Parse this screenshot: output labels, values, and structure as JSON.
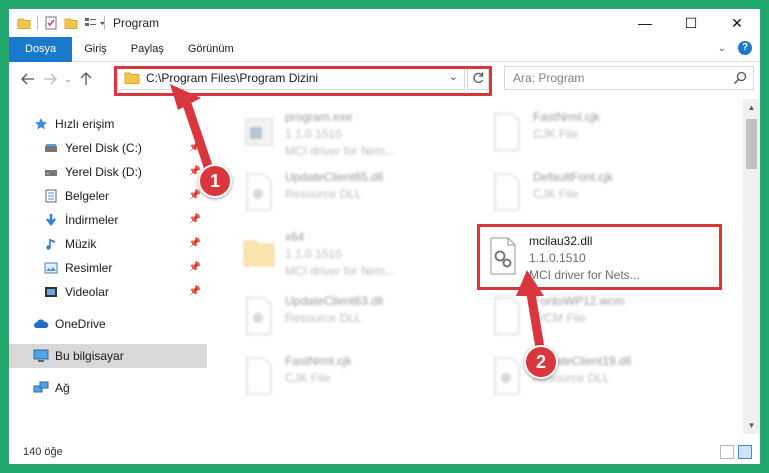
{
  "window": {
    "title": "Program",
    "controls": {
      "minimize": "—",
      "maximize": "☐",
      "close": "✕"
    }
  },
  "ribbon": {
    "tabs": [
      {
        "label": "Dosya",
        "active": true
      },
      {
        "label": "Giriş"
      },
      {
        "label": "Paylaş"
      },
      {
        "label": "Görünüm"
      }
    ],
    "help": "?"
  },
  "address": {
    "path": "C:\\Program Files\\Program Dizini",
    "search_placeholder": "Ara: Program"
  },
  "navpane": {
    "items": [
      {
        "label": "Hızlı erişim",
        "icon": "star-icon"
      },
      {
        "label": "Yerel Disk (C:)",
        "icon": "drive-icon",
        "pinned": true
      },
      {
        "label": "Yerel Disk (D:)",
        "icon": "drive-icon",
        "pinned": true
      },
      {
        "label": "Belgeler",
        "icon": "documents-icon",
        "pinned": true
      },
      {
        "label": "İndirmeler",
        "icon": "download-icon",
        "pinned": true
      },
      {
        "label": "Müzik",
        "icon": "music-icon",
        "pinned": true
      },
      {
        "label": "Resimler",
        "icon": "pictures-icon",
        "pinned": true
      },
      {
        "label": "Videolar",
        "icon": "videos-icon",
        "pinned": true
      },
      {
        "label": "OneDrive",
        "icon": "onedrive-icon"
      },
      {
        "label": "Bu bilgisayar",
        "icon": "computer-icon",
        "selected": true
      },
      {
        "label": "Ağ",
        "icon": "network-icon"
      }
    ]
  },
  "files": [
    {
      "name": "program.exe",
      "line2": "1.1.0.1510",
      "line3": "MCI driver for Nets...",
      "icon": "exe-icon",
      "faded": true
    },
    {
      "name": "FastNrml.cjk",
      "line2": "CJK File",
      "line3": "",
      "icon": "file-icon",
      "faded": true
    },
    {
      "name": "UpdateClient65.dll",
      "line2": "Resource DLL",
      "line3": "",
      "icon": "dll-icon",
      "faded": true
    },
    {
      "name": "DefaultFont.cjk",
      "line2": "CJK File",
      "line3": "",
      "icon": "file-icon",
      "faded": true
    },
    {
      "name": "x64",
      "line2": "1.1.0.1510",
      "line3": "MCI driver for Nets...",
      "icon": "folder-icon",
      "faded": true
    },
    {
      "name": "mcilau32.dll",
      "line2": "1.1.0.1510",
      "line3": "MCI driver for Nets...",
      "icon": "dll-icon",
      "faded": false
    },
    {
      "name": "UpdateClient63.dll",
      "line2": "Resource DLL",
      "line3": "",
      "icon": "dll-icon",
      "faded": true
    },
    {
      "name": "FontoWP12.wcm",
      "line2": "WCM File",
      "line3": "",
      "icon": "file-icon",
      "faded": true
    },
    {
      "name": "FastNrml.cjk",
      "line2": "CJK File",
      "line3": "",
      "icon": "file-icon",
      "faded": true
    },
    {
      "name": "UpdateClient19.dll",
      "line2": "Resource DLL",
      "line3": "",
      "icon": "dll-icon",
      "faded": true
    }
  ],
  "status": {
    "count": "140 öğe"
  },
  "annotations": {
    "step1": "1",
    "step2": "2",
    "color": "#d9363e"
  }
}
